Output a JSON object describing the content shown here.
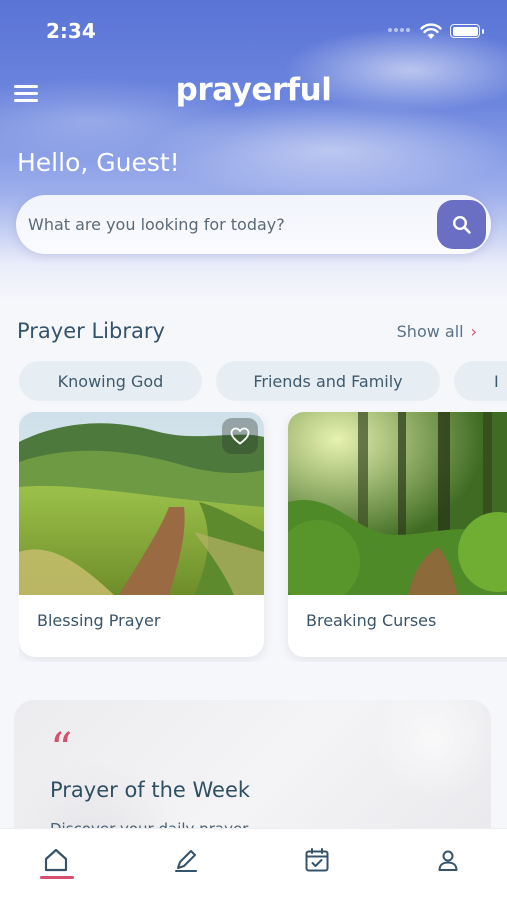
{
  "status_bar": {
    "time": "2:34"
  },
  "app": {
    "logo": "prayerful"
  },
  "greeting": "Hello, Guest!",
  "search": {
    "placeholder": "What are you looking for today?"
  },
  "library": {
    "title": "Prayer Library",
    "show_all_label": "Show all",
    "chips": [
      "Knowing God",
      "Friends and Family",
      "I"
    ],
    "cards": [
      {
        "title": "Blessing Prayer",
        "favorite": false
      },
      {
        "title": "Breaking Curses"
      }
    ]
  },
  "prayer_of_week": {
    "quote_mark": "“",
    "title": "Prayer of the Week",
    "snippet": "Discover your daily prayer"
  },
  "tabs": [
    "home-icon",
    "pen-icon",
    "calendar-check-icon",
    "user-icon"
  ],
  "colors": {
    "accent": "#d4506f",
    "primary": "#6a6fc4",
    "sky": "#5a74d6",
    "text": "#35536b"
  }
}
